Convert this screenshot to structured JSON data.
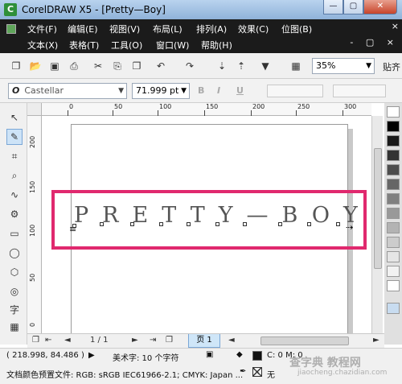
{
  "window": {
    "title": "CorelDRAW X5 - [Pretty—Boy]",
    "minimize_label": "—",
    "maximize_label": "▢",
    "close_label": "✕"
  },
  "menu": {
    "row1": [
      "文件(F)",
      "编辑(E)",
      "视图(V)",
      "布局(L)",
      "排列(A)",
      "效果(C)",
      "位图(B)"
    ],
    "row2": [
      "文本(X)",
      "表格(T)",
      "工具(O)",
      "窗口(W)",
      "帮助(H)"
    ],
    "doc_close": "×",
    "doc_controls": "- ▢ ×"
  },
  "toolbar": {
    "zoom": "35%",
    "snap_label": "贴齐"
  },
  "property_bar": {
    "font_name": "Castellar",
    "font_size": "71.999 pt",
    "font_icon": "O",
    "bold_label": "B",
    "italic_label": "I",
    "underline_label": "U"
  },
  "rulers": {
    "h_ticks": [
      "0",
      "50",
      "100",
      "150",
      "200",
      "250",
      "300"
    ],
    "v_ticks": [
      "200",
      "150",
      "100",
      "50",
      "0"
    ]
  },
  "canvas": {
    "art_text": "PRETTY—BOY"
  },
  "page_nav": {
    "first": "⇤",
    "prev": "◄",
    "counter": "1 / 1",
    "next": "►",
    "last": "⇥",
    "page_tab": "页 1"
  },
  "status": {
    "coordinates": "( 218.998, 84.486 )",
    "object_info": "美术字: 10 个字符",
    "color_profile": "文档颜色预置文件: RGB: sRGB IEC61966-2.1; CMYK: Japan ...",
    "fill_info": "C: 0 M: 0",
    "outline_info": "无"
  },
  "watermark": {
    "main": "查字典 教程网",
    "sub": "jiaocheng.chazidian.com"
  },
  "colors": {
    "menubar_bg": "#1b1b1b",
    "highlight": "#e0296e",
    "titlebar": "#b9d3ee"
  }
}
